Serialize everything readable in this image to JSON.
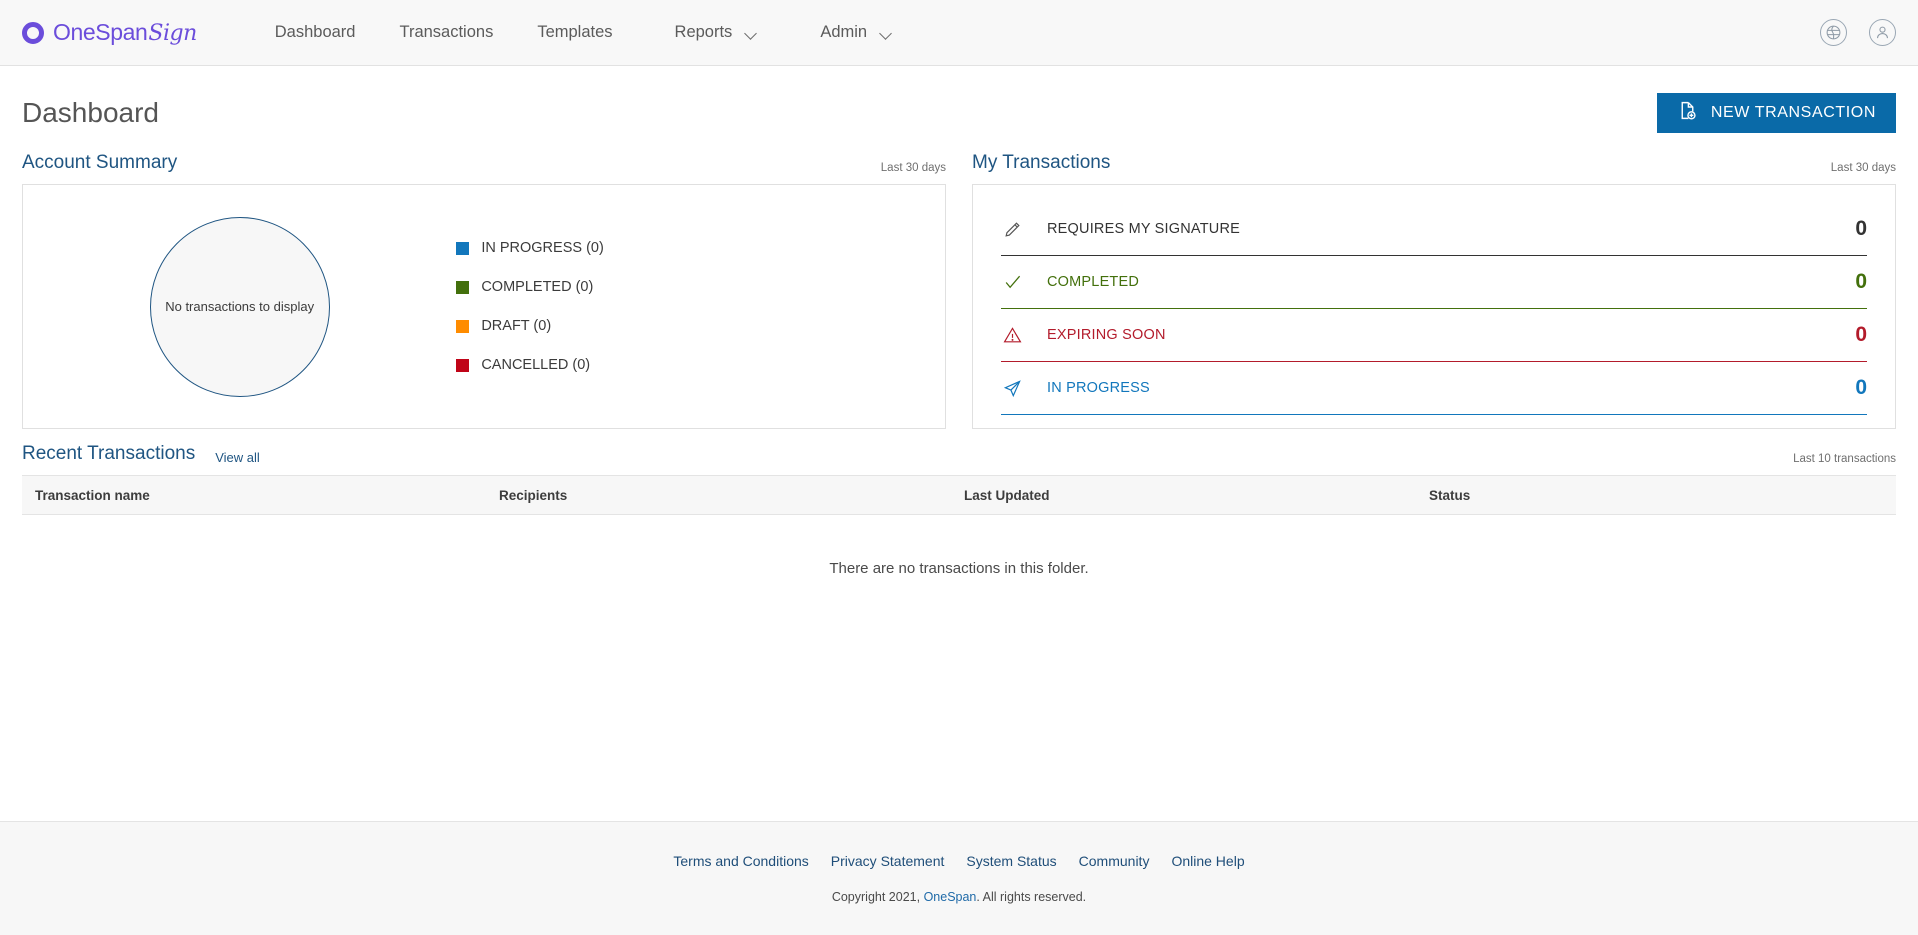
{
  "header": {
    "logo": {
      "ring_icon": "onespan-ring-icon",
      "name": "OneSpan",
      "script": "Sign",
      "color": "#6b4ddb"
    },
    "nav": [
      {
        "label": "Dashboard",
        "has_caret": false
      },
      {
        "label": "Transactions",
        "has_caret": false
      },
      {
        "label": "Templates",
        "has_caret": false
      },
      {
        "label": "Reports",
        "has_caret": true
      },
      {
        "label": "Admin",
        "has_caret": true
      }
    ],
    "icons": [
      {
        "name": "globe-icon",
        "glyph": "♁"
      },
      {
        "name": "user-account-icon",
        "glyph": "①"
      }
    ]
  },
  "page": {
    "title": "Dashboard",
    "new_transaction_label": "NEW TRANSACTION",
    "new_transaction_color": "#0a6aa8"
  },
  "account_summary": {
    "title": "Account Summary",
    "note": "Last 30 days",
    "empty_text": "No transactions to display"
  },
  "my_transactions": {
    "title": "My Transactions",
    "note": "Last 30 days",
    "rows": [
      {
        "icon": "pencil-icon",
        "label": "REQUIRES MY SIGNATURE",
        "count": "0",
        "color": "#333333"
      },
      {
        "icon": "check-icon",
        "label": "COMPLETED",
        "count": "0",
        "color": "#43700c"
      },
      {
        "icon": "warning-icon",
        "label": "EXPIRING SOON",
        "count": "0",
        "color": "#b31b2b"
      },
      {
        "icon": "paper-plane-icon",
        "label": "IN PROGRESS",
        "count": "0",
        "color": "#1277bc"
      }
    ]
  },
  "recent_transactions": {
    "title": "Recent Transactions",
    "view_all_label": "View all",
    "note": "Last 10 transactions",
    "columns": [
      "Transaction name",
      "Recipients",
      "Last Updated",
      "Status"
    ],
    "rows": [],
    "empty_text": "There are no transactions in this folder."
  },
  "footer": {
    "links": [
      "Terms and Conditions",
      "Privacy Statement",
      "System Status",
      "Community",
      "Online Help"
    ],
    "copyright_prefix": "Copyright 2021, ",
    "copyright_brand": "OneSpan",
    "copyright_suffix": ". All rights reserved."
  },
  "chart_data": {
    "type": "pie",
    "title": "Account Summary",
    "subtitle": "Last 30 days",
    "empty": true,
    "empty_text": "No transactions to display",
    "legend_position": "right",
    "categories": [
      "IN PROGRESS",
      "COMPLETED",
      "DRAFT",
      "CANCELLED"
    ],
    "values": [
      0,
      0,
      0,
      0
    ],
    "colors": [
      "#1277bc",
      "#43700c",
      "#ff8c00",
      "#c00418"
    ],
    "legend_labels": [
      "IN PROGRESS (0)",
      "COMPLETED (0)",
      "DRAFT (0)",
      "CANCELLED (0)"
    ]
  }
}
